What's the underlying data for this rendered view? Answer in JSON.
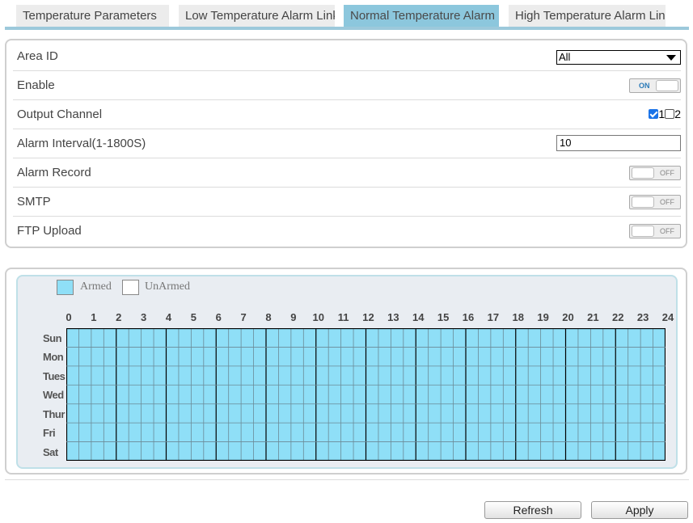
{
  "tabs": [
    {
      "label": "Temperature Parameters",
      "active": false
    },
    {
      "label": "Low Temperature Alarm Linkage",
      "active": false
    },
    {
      "label": "Normal Temperature Alarm Linkage",
      "active": true
    },
    {
      "label": "High Temperature Alarm Linkage",
      "active": false
    }
  ],
  "settings": {
    "area_id": {
      "label": "Area ID",
      "value": "All"
    },
    "enable": {
      "label": "Enable",
      "state": "ON"
    },
    "output_channel": {
      "label": "Output Channel",
      "ch1": "1",
      "ch1_checked": true,
      "ch2": "2",
      "ch2_checked": false
    },
    "alarm_interval": {
      "label": "Alarm Interval(1-1800S)",
      "value": "10"
    },
    "alarm_record": {
      "label": "Alarm Record",
      "state": "OFF"
    },
    "smtp": {
      "label": "SMTP",
      "state": "OFF"
    },
    "ftp_upload": {
      "label": "FTP Upload",
      "state": "OFF"
    }
  },
  "schedule": {
    "legend": {
      "armed": "Armed",
      "unarmed": "UnArmed"
    },
    "colors": {
      "armed": "#8fdff7",
      "unarmed": "#ffffff"
    },
    "hours": [
      "0",
      "1",
      "2",
      "3",
      "4",
      "5",
      "6",
      "7",
      "8",
      "9",
      "10",
      "11",
      "12",
      "13",
      "14",
      "15",
      "16",
      "17",
      "18",
      "19",
      "20",
      "21",
      "22",
      "23",
      "24"
    ],
    "days": [
      "Sun",
      "Mon",
      "Tues",
      "Wed",
      "Thur",
      "Fri",
      "Sat"
    ],
    "armed_all": true
  },
  "buttons": {
    "refresh": "Refresh",
    "apply": "Apply"
  }
}
